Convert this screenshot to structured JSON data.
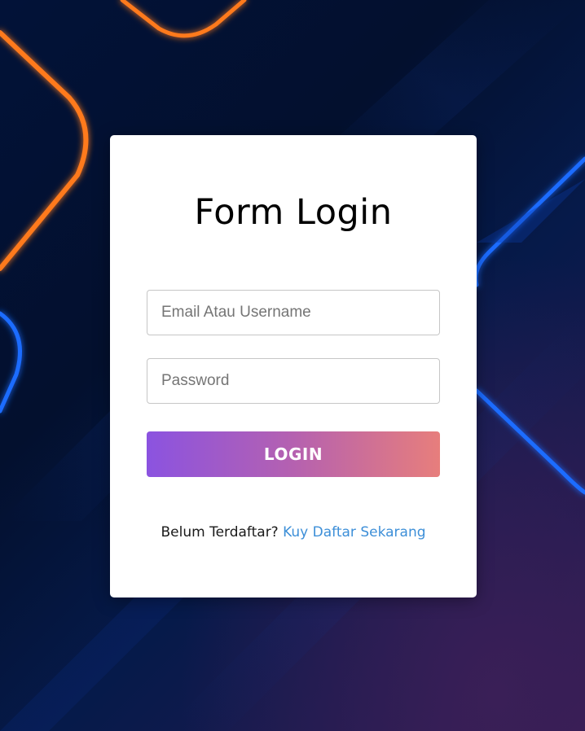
{
  "login_form": {
    "title": "Form Login",
    "email_placeholder": "Email Atau Username",
    "email_value": "",
    "password_placeholder": "Password",
    "password_value": "",
    "login_label": "LOGIN",
    "register_prompt": "Belum Terdaftar?",
    "register_link": "Kuy Daftar Sekarang"
  },
  "colors": {
    "card_background": "#ffffff",
    "button_gradient_start": "#8b53e0",
    "button_gradient_end": "#e77e7c",
    "link": "#3d8fd8",
    "background_dark": "#03102e",
    "neon_orange": "#ff7a1f",
    "neon_blue": "#1a6cff"
  }
}
